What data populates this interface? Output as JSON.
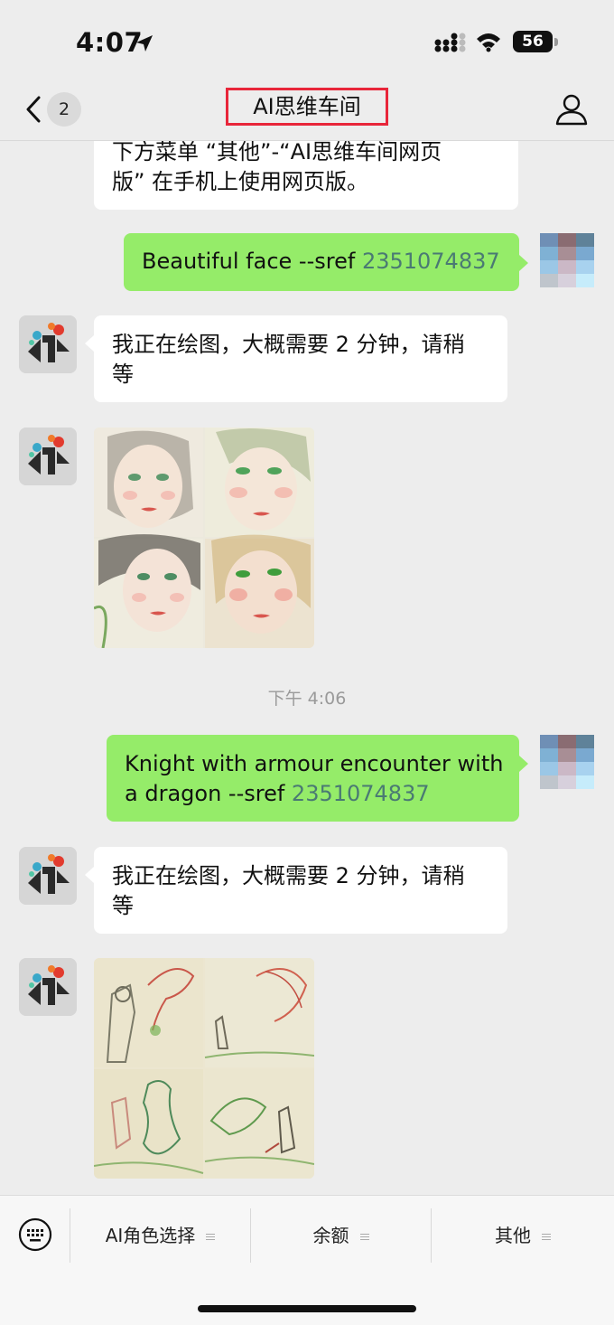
{
  "status_bar": {
    "time": "4:07",
    "battery_level": "56"
  },
  "nav": {
    "unread_count": "2",
    "title": "AI思维车间"
  },
  "messages": [
    {
      "from": "bot",
      "text": "下方菜单 “其他”-“AI思维车间网页版” 在手机上使用网页版。"
    },
    {
      "from": "user",
      "text": "Beautiful face --sref ",
      "sref": "2351074837"
    },
    {
      "from": "bot",
      "text": "我正在绘图，大概需要 2 分钟，请稍等"
    },
    {
      "from": "bot",
      "image": "four-face-portraits"
    },
    {
      "timestamp": "下午 4:06"
    },
    {
      "from": "user",
      "text": "Knight with armour encounter with a dragon --sref ",
      "sref": "2351074837"
    },
    {
      "from": "bot",
      "text": "我正在绘图，大概需要 2 分钟，请稍等"
    },
    {
      "from": "bot",
      "image": "knight-dragon-sketches"
    }
  ],
  "bubble_lines": {
    "m0_line1": "下方菜单 “其他”-“AI思维车间网页",
    "m0_line2": "版” 在手机上使用网页版。",
    "m1_text": "Beautiful face --sref ",
    "m1_sref": "2351074837",
    "m2_line1": "我正在绘图，大概需要 2 分钟，请稍",
    "m2_line2": "等",
    "ts": "下午 4:06",
    "m5_line1": "Knight with armour encounter with",
    "m5_line2": "a dragon --sref ",
    "m5_sref": "2351074837",
    "m6_line1": "我正在绘图，大概需要 2 分钟，请稍",
    "m6_line2": "等"
  },
  "menu": {
    "items": [
      {
        "label": "AI角色选择"
      },
      {
        "label": "余额"
      },
      {
        "label": "其他"
      }
    ]
  },
  "colors": {
    "outgoing_bubble": "#95ec69",
    "incoming_bubble": "#ffffff",
    "title_highlight": "#e8263a",
    "sref_link": "#4a7a73"
  }
}
